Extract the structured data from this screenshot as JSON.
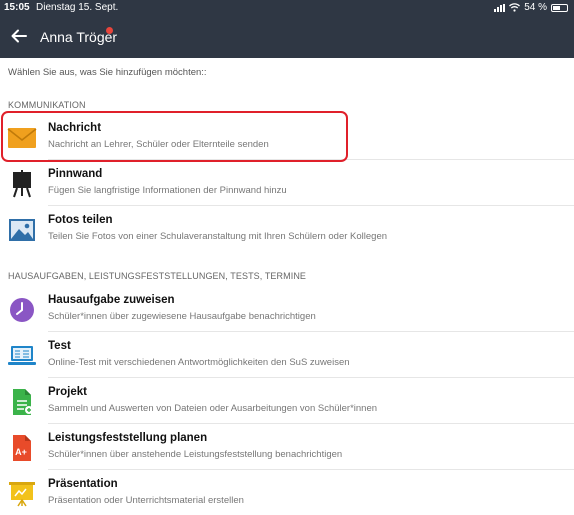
{
  "status": {
    "time": "15:05",
    "date": "Dienstag 15. Sept.",
    "battery": "54 %"
  },
  "header": {
    "title": "Anna Tröger"
  },
  "intro": "Wählen Sie aus, was Sie hinzufügen möchten::",
  "sections": {
    "kommunikation": "KOMMUNIKATION",
    "hausaufgaben": "HAUSAUFGABEN, LEISTUNGSFESTSTELLUNGEN, TESTS, TERMINE"
  },
  "items": {
    "nachricht": {
      "title": "Nachricht",
      "desc": "Nachricht an Lehrer, Schüler oder Elternteile senden",
      "icon": "envelope-icon"
    },
    "pinnwand": {
      "title": "Pinnwand",
      "desc": "Fügen Sie langfristige Informationen der Pinnwand hinzu",
      "icon": "pinboard-icon"
    },
    "fotos": {
      "title": "Fotos teilen",
      "desc": "Teilen Sie Fotos von einer Schulaveranstaltung mit Ihren Schülern oder Kollegen",
      "icon": "photo-icon"
    },
    "hausaufgabe": {
      "title": "Hausaufgabe zuweisen",
      "desc": "Schüler*innen über zugewiesene Hausaufgabe benachrichtigen",
      "icon": "clock-icon"
    },
    "test": {
      "title": "Test",
      "desc": "Online-Test mit verschiedenen Antwortmöglichkeiten den SuS zuweisen",
      "icon": "laptop-icon"
    },
    "projekt": {
      "title": "Projekt",
      "desc": "Sammeln und Auswerten von Dateien oder Ausarbeitungen von Schüler*innen",
      "icon": "document-icon"
    },
    "leistung": {
      "title": "Leistungsfeststellung planen",
      "desc": "Schüler*innen über anstehende Leistungsfeststellung benachrichtigen",
      "icon": "grade-icon",
      "badge": "A+"
    },
    "praesentation": {
      "title": "Präsentation",
      "desc": "Präsentation oder Unterrichtsmaterial erstellen",
      "icon": "presentation-icon"
    }
  },
  "colors": {
    "header_bg": "#2f3744",
    "highlight": "#e0202a",
    "envelope": "#f0a01e",
    "photo": "#2f6fa8",
    "clock": "#8a56c4",
    "laptop": "#1f85c9",
    "document": "#3bb34a",
    "grade": "#e84b2a",
    "presentation": "#f2c21b"
  }
}
